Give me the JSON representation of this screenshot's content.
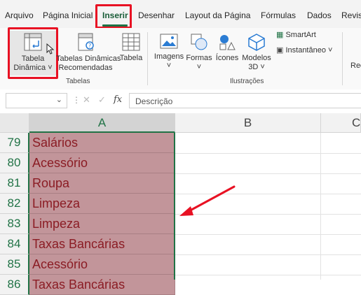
{
  "tabs": [
    {
      "label": "Arquivo"
    },
    {
      "label": "Página Inicial"
    },
    {
      "label": "Inserir"
    },
    {
      "label": "Desenhar"
    },
    {
      "label": "Layout da Página"
    },
    {
      "label": "Fórmulas"
    },
    {
      "label": "Dados"
    },
    {
      "label": "Revis"
    }
  ],
  "ribbon": {
    "tabela_dinamica": {
      "line1": "Tabela",
      "line2": "Dinâmica ˅"
    },
    "tabelas_recomendadas": {
      "line1": "Tabelas Dinâmicas",
      "line2": "Recomendadas"
    },
    "tabela": {
      "line1": "Tabela"
    },
    "imagens": {
      "line1": "Imagens",
      "line2": "˅"
    },
    "formas": {
      "line1": "Formas",
      "line2": "˅"
    },
    "icones": {
      "line1": "Ícones"
    },
    "modelos3d": {
      "line1": "Modelos",
      "line2": "3D ˅"
    },
    "smartart": {
      "label": "SmartArt"
    },
    "instantaneo": {
      "label": "Instantâneo ˅"
    },
    "cut_label": "Rec",
    "groups": {
      "tabelas": "Tabelas",
      "ilustracoes": "Ilustrações"
    }
  },
  "formula_bar": {
    "name_box_value": "",
    "fx": "fx",
    "content": "Descrição"
  },
  "columns": [
    "A",
    "B",
    "C"
  ],
  "rows": [
    {
      "num": "79",
      "value": "Salários"
    },
    {
      "num": "80",
      "value": "Acessório"
    },
    {
      "num": "81",
      "value": "Roupa"
    },
    {
      "num": "82",
      "value": "Limpeza"
    },
    {
      "num": "83",
      "value": "Limpeza"
    },
    {
      "num": "84",
      "value": "Taxas Bancárias"
    },
    {
      "num": "85",
      "value": "Acessório"
    },
    {
      "num": "86",
      "value": "Taxas Bancárias"
    }
  ],
  "colors": {
    "accent": "#217346",
    "highlight": "#e81123",
    "cell_fill": "#c2959a",
    "cell_text": "#8b1c24"
  }
}
